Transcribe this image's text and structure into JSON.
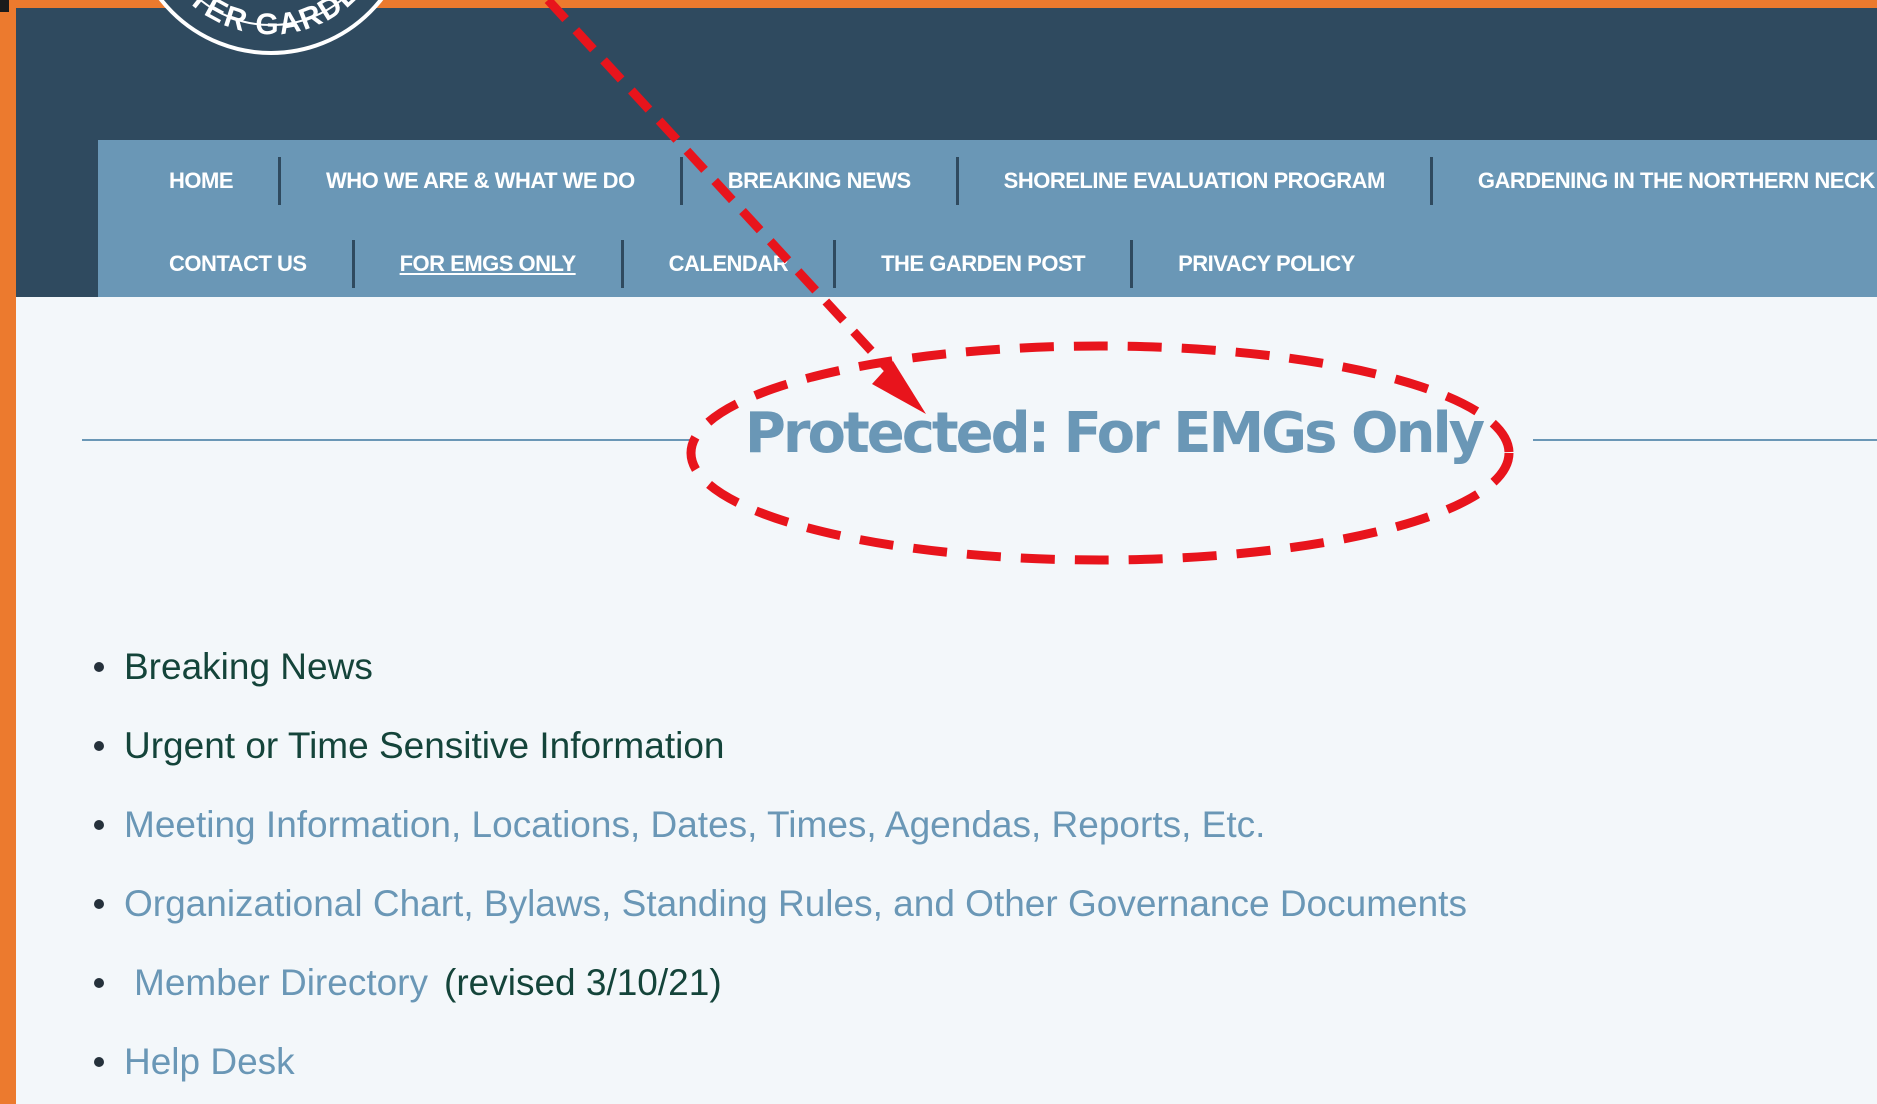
{
  "logo": {
    "arc_text": "ASTER GARDENE"
  },
  "nav": {
    "row1": [
      "HOME",
      "WHO WE ARE & WHAT WE DO",
      "BREAKING NEWS",
      "SHORELINE EVALUATION PROGRAM",
      "GARDENING IN THE NORTHERN NECK"
    ],
    "row2": [
      "CONTACT US",
      "FOR EMGS ONLY",
      "CALENDAR",
      "THE GARDEN POST",
      "PRIVACY POLICY"
    ]
  },
  "page": {
    "title": "Protected: For EMGs Only"
  },
  "links": {
    "breaking_news": "Breaking News",
    "urgent": "Urgent or Time Sensitive Information",
    "meeting": "Meeting Information, Locations, Dates, Times, Agendas, Reports, Etc.",
    "org": "Organizational Chart, Bylaws, Standing Rules, and Other Governance Documents",
    "directory": "Member Directory",
    "directory_note": "(revised 3/10/21)",
    "help": "Help Desk"
  },
  "colors": {
    "frame": "#ec7a2e",
    "header": "#2f4a5f",
    "nav": "#6a97b6",
    "annotation": "#e8141c"
  }
}
